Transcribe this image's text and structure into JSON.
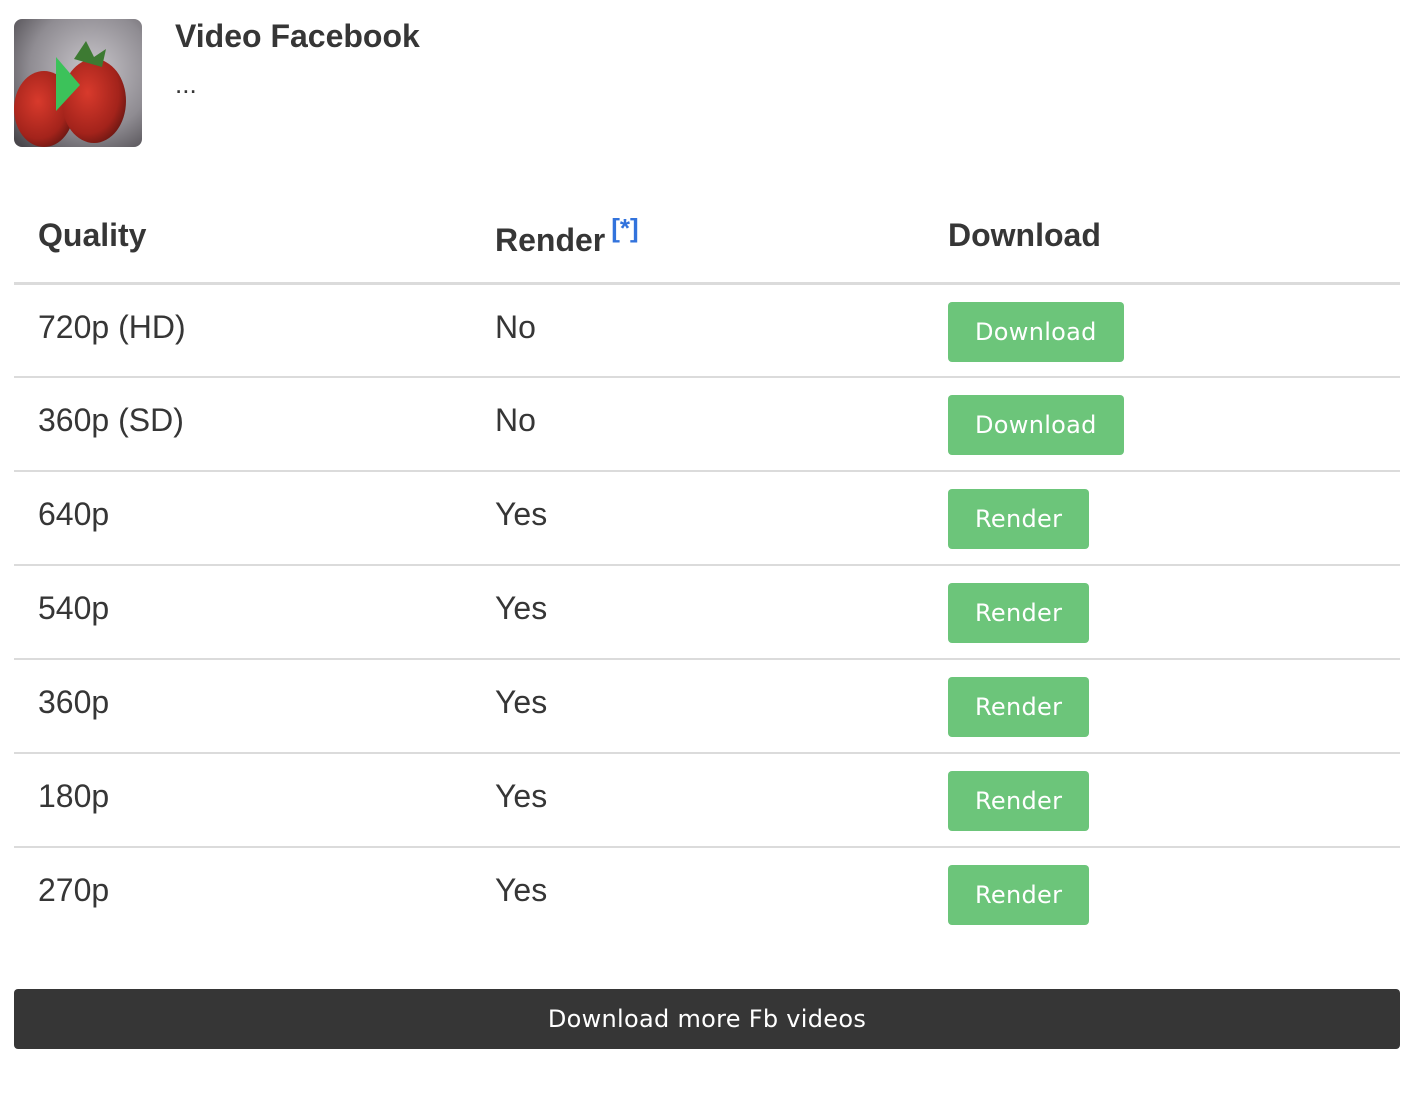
{
  "video": {
    "title": "Video Facebook",
    "description": "..."
  },
  "table": {
    "headers": {
      "quality": "Quality",
      "render": "Render",
      "render_note": "[*]",
      "download": "Download"
    },
    "rows": [
      {
        "quality": "720p (HD)",
        "render": "No",
        "action": "Download"
      },
      {
        "quality": "360p (SD)",
        "render": "No",
        "action": "Download"
      },
      {
        "quality": "640p",
        "render": "Yes",
        "action": "Render"
      },
      {
        "quality": "540p",
        "render": "Yes",
        "action": "Render"
      },
      {
        "quality": "360p",
        "render": "Yes",
        "action": "Render"
      },
      {
        "quality": "180p",
        "render": "Yes",
        "action": "Render"
      },
      {
        "quality": "270p",
        "render": "Yes",
        "action": "Render"
      }
    ]
  },
  "footer": {
    "more_label": "Download more Fb videos"
  },
  "colors": {
    "button_green": "#6cc57a",
    "button_dark": "#363636",
    "link_blue": "#3273dc"
  }
}
